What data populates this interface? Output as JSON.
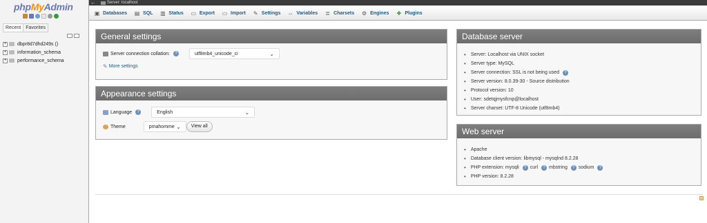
{
  "sidebar": {
    "logo": {
      "php": "php",
      "my": "My",
      "admin": "Admin"
    },
    "logo_icons": [
      {
        "icon": "home-icon",
        "color": "#c08a3a"
      },
      {
        "icon": "sql-icon",
        "color": "#6c78af"
      },
      {
        "icon": "docs-icon",
        "color": "#6a9fd8"
      },
      {
        "icon": "help-icon",
        "color": "#e8e8e8"
      },
      {
        "icon": "settings-icon",
        "color": "#999999"
      },
      {
        "icon": "reload-icon",
        "color": "#3a9a3a"
      }
    ],
    "tabs": {
      "recent": "Recent",
      "favorites": "Favorites"
    },
    "databases": [
      {
        "name": "dbpr8d7dhd249s ()"
      },
      {
        "name": "information_schema"
      },
      {
        "name": "performance_schema"
      }
    ]
  },
  "topbar": {
    "collapse": "←",
    "breadcrumb": "Server: localhost"
  },
  "menu": [
    {
      "icon": "databases-icon",
      "glyph": "▣",
      "label": "Databases"
    },
    {
      "icon": "sql-icon",
      "glyph": "▤",
      "label": "SQL"
    },
    {
      "icon": "status-icon",
      "glyph": "▥",
      "label": "Status"
    },
    {
      "icon": "export-icon",
      "glyph": "▭",
      "label": "Export"
    },
    {
      "icon": "import-icon",
      "glyph": "▭",
      "label": "Import"
    },
    {
      "icon": "settings-icon",
      "glyph": "✎",
      "label": "Settings"
    },
    {
      "icon": "variables-icon",
      "glyph": "⇔",
      "label": "Variables"
    },
    {
      "icon": "charsets-icon",
      "glyph": "≣",
      "label": "Charsets"
    },
    {
      "icon": "engines-icon",
      "glyph": "⚙",
      "label": "Engines"
    },
    {
      "icon": "plugins-icon",
      "glyph": "✚",
      "label": "Plugins"
    }
  ],
  "general": {
    "title": "General settings",
    "collation_label": "Server connection collation:",
    "collation_value": "utf8mb4_unicode_ci",
    "more_settings": "More settings"
  },
  "appearance": {
    "title": "Appearance settings",
    "language_label": "Language",
    "language_value": "English",
    "theme_label": "Theme",
    "theme_value": "pmahomme",
    "view_all": "View all"
  },
  "db_server": {
    "title": "Database server",
    "items": [
      "Server: Localhost via UNIX socket",
      "Server type: MySQL",
      "Server connection: SSL is not being used",
      "Server version: 8.0.39-30 - Source distribution",
      "Protocol version: 10",
      "User: sdetqjmysfcnp@localhost",
      "Server charset: UTF-8 Unicode (utf8mb4)"
    ]
  },
  "web_server": {
    "title": "Web server",
    "apache": "Apache",
    "client_version": "Database client version: libmysql - mysqlnd 8.2.28",
    "php_ext_label": "PHP extension: mysqli",
    "ext_curl": "curl",
    "ext_mbstring": "mbstring",
    "ext_sodium": "sodium",
    "php_version": "PHP version: 8.2.28"
  }
}
